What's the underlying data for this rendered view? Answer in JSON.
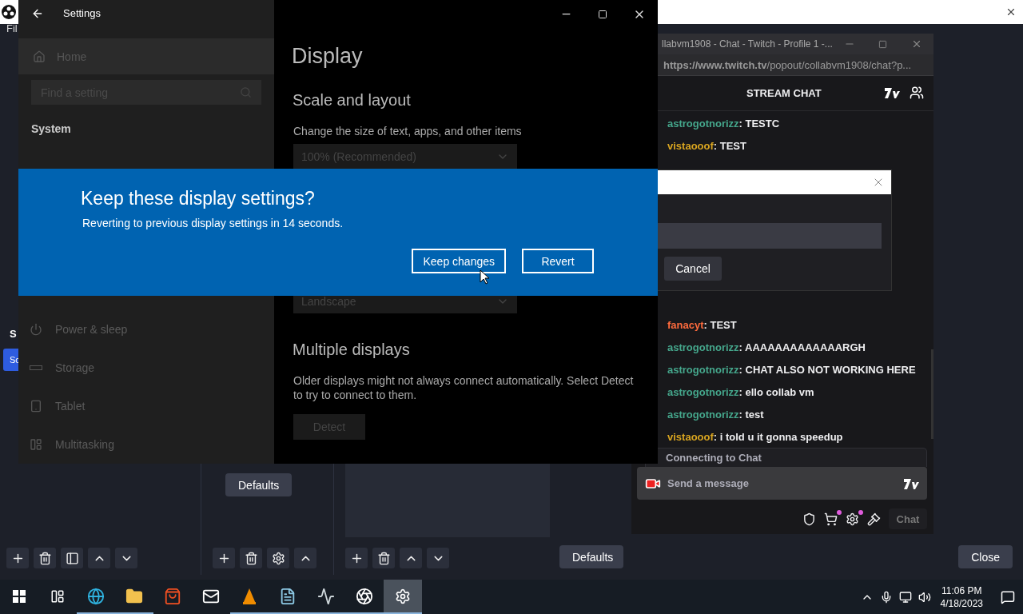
{
  "obs": {
    "menu": "Fil",
    "scene_tab": "S",
    "scene_item": {
      "label": "Sc",
      "selected": true
    },
    "docks": [
      {
        "buttons": [
          {
            "kind": "add"
          },
          {
            "kind": "remove"
          },
          {
            "kind": "filter"
          },
          {
            "kind": "up"
          },
          {
            "kind": "down"
          }
        ]
      },
      {
        "defaults": "Defaults",
        "buttons": [
          {
            "kind": "add"
          },
          {
            "kind": "remove"
          },
          {
            "kind": "settings"
          },
          {
            "kind": "up"
          }
        ]
      },
      {
        "defaults": "Defaults",
        "buttons": [
          {
            "kind": "add"
          },
          {
            "kind": "remove"
          },
          {
            "kind": "up"
          },
          {
            "kind": "down"
          }
        ]
      }
    ],
    "close_button": "Close"
  },
  "chat_window": {
    "title": "llabvm1908 - Chat - Twitch - Profile 1 -...",
    "url": "**https://www.twitch.tv**/popout/collabvm1908/chat?p...",
    "header": "STREAM CHAT",
    "messages": [
      {
        "user": "astrogotnorizz",
        "color": "#45a78c",
        "text": ": TESTC"
      },
      {
        "user": "vistaooof",
        "color": "#d9a520",
        "text": ": TEST"
      },
      {
        "user": "fanacyt",
        "color": "#ff6b3d",
        "text": ": TEST"
      },
      {
        "user": "astrogotnorizz",
        "color": "#45a78c",
        "text": ": AAAAAAAAAAAAARGH"
      },
      {
        "user": "astrogotnorizz",
        "color": "#45a78c",
        "text": ": CHAT ALSO NOT WORKING HERE"
      },
      {
        "user": "astrogotnorizz",
        "color": "#45a78c",
        "text": ": ello collab vm"
      },
      {
        "user": "astrogotnorizz",
        "color": "#45a78c",
        "text": ": test"
      },
      {
        "user": "vistaooof",
        "color": "#d9a520",
        "text": ": i told u it gonna speedup"
      }
    ],
    "popup": {
      "cancel": "Cancel"
    },
    "status": "Connecting to Chat",
    "input": {
      "placeholder": "Send a message"
    },
    "chat_button": "Chat"
  },
  "settings": {
    "title": "Settings",
    "home": "Home",
    "search": {
      "placeholder": "Find a setting"
    },
    "section": "System",
    "items": [
      {
        "kind": "power",
        "label": "Power & sleep"
      },
      {
        "kind": "storage",
        "label": "Storage"
      },
      {
        "kind": "tablet",
        "label": "Tablet"
      },
      {
        "kind": "multitasking",
        "label": "Multitasking"
      }
    ],
    "page": {
      "title": "Display",
      "section": "Scale and layout",
      "scale_label": "Change the size of text, apps, and other items",
      "scale_value": "100% (Recommended)",
      "orientation_value": "Landscape",
      "multi_title": "Multiple displays",
      "multi_text": "Older displays might not always connect automatically. Select Detect to try to connect to them.",
      "detect": "Detect"
    }
  },
  "dialog": {
    "title": "Keep these display settings?",
    "message": "Reverting to previous display settings in 14 seconds.",
    "buttons": [
      "Keep changes",
      "Revert"
    ]
  },
  "taskbar": {
    "apps": [
      {
        "kind": "edge",
        "running": true,
        "selected": false
      },
      {
        "kind": "explorer",
        "running": true,
        "selected": false
      },
      {
        "kind": "store",
        "running": false,
        "selected": false
      },
      {
        "kind": "mail",
        "running": false,
        "selected": false
      },
      {
        "kind": "vlc",
        "running": true,
        "selected": false
      },
      {
        "kind": "notepad",
        "running": true,
        "selected": false
      },
      {
        "kind": "monitor",
        "running": true,
        "selected": false
      },
      {
        "kind": "obs",
        "running": true,
        "selected": false
      },
      {
        "kind": "settings",
        "running": true,
        "selected": true
      }
    ],
    "clock": {
      "time": "11:06 PM",
      "date": "4/18/2023"
    }
  }
}
